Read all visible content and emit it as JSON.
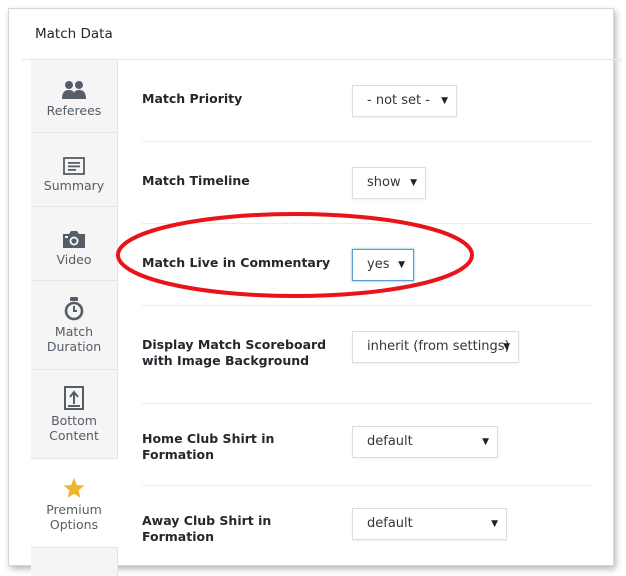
{
  "panel": {
    "title": "Match Data"
  },
  "sidebar": {
    "tabs": [
      {
        "label": "Referees",
        "icon": "users-icon"
      },
      {
        "label": "Summary",
        "icon": "summary-icon"
      },
      {
        "label": "Video",
        "icon": "camera-icon"
      },
      {
        "label": "Match\nDuration",
        "icon": "stopwatch-icon"
      },
      {
        "label": "Bottom\nContent",
        "icon": "bottom-content-icon"
      },
      {
        "label": "Premium\nOptions",
        "icon": "star-icon",
        "active": true
      }
    ]
  },
  "fields": [
    {
      "label": "Match Priority",
      "value": "- not set -"
    },
    {
      "label": "Match Timeline",
      "value": "show"
    },
    {
      "label": "Match Live in Commentary",
      "value": "yes"
    },
    {
      "label": "Display Match Scoreboard with Image Background",
      "value": "inherit (from settings)"
    },
    {
      "label": "Home Club Shirt in Formation",
      "value": "default"
    },
    {
      "label": "Away Club Shirt in Formation",
      "value": "default"
    }
  ],
  "colors": {
    "highlight": "#e8141a",
    "star": "#f0b429",
    "icon": "#555d66",
    "focus": "#5b9dd9"
  }
}
